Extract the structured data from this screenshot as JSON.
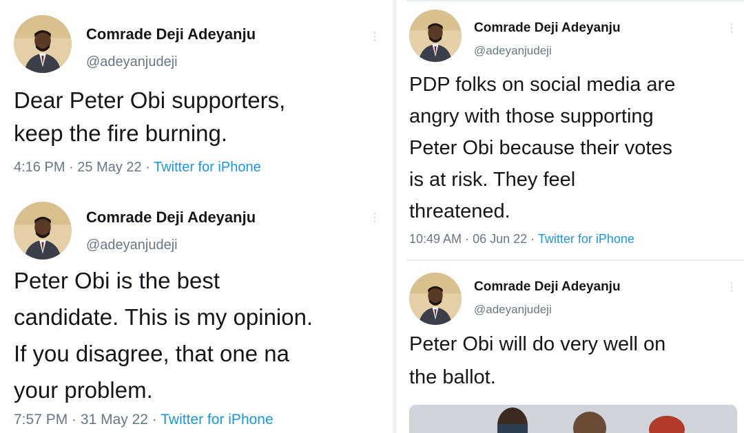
{
  "tweets": [
    {
      "name": "Comrade Deji Adeyanju",
      "handle": "@adeyanjudeji",
      "text_lines": [
        "Dear Peter Obi supporters,",
        "keep the fire burning."
      ],
      "time": "4:16 PM",
      "date": "25 May 22",
      "source": "Twitter for iPhone"
    },
    {
      "name": "Comrade Deji Adeyanju",
      "handle": "@adeyanjudeji",
      "text_lines": [
        "Peter Obi is the best",
        "candidate. This is my opinion.",
        "If you disagree, that one na",
        "your problem."
      ],
      "time": "7:57 PM",
      "date": "31 May 22",
      "source": "Twitter for iPhone"
    },
    {
      "name": "Comrade Deji Adeyanju",
      "handle": "@adeyanjudeji",
      "text_lines": [
        "PDP folks on social media are",
        "angry with those supporting",
        "Peter Obi because their votes",
        "is at risk. They feel",
        "threatened."
      ],
      "time": "10:49 AM",
      "date": "06 Jun 22",
      "source": "Twitter for iPhone"
    },
    {
      "name": "Comrade Deji Adeyanju",
      "handle": "@adeyanjudeji",
      "text_lines": [
        "Peter Obi will do very well on",
        "the ballot."
      ],
      "time": "",
      "date": "",
      "source": ""
    }
  ],
  "separator": " · ",
  "icons": {
    "avatar": "profile-photo",
    "more": "more-options-icon"
  },
  "colors": {
    "text": "#14171a",
    "secondary": "#657786",
    "link": "#1b95e0"
  }
}
